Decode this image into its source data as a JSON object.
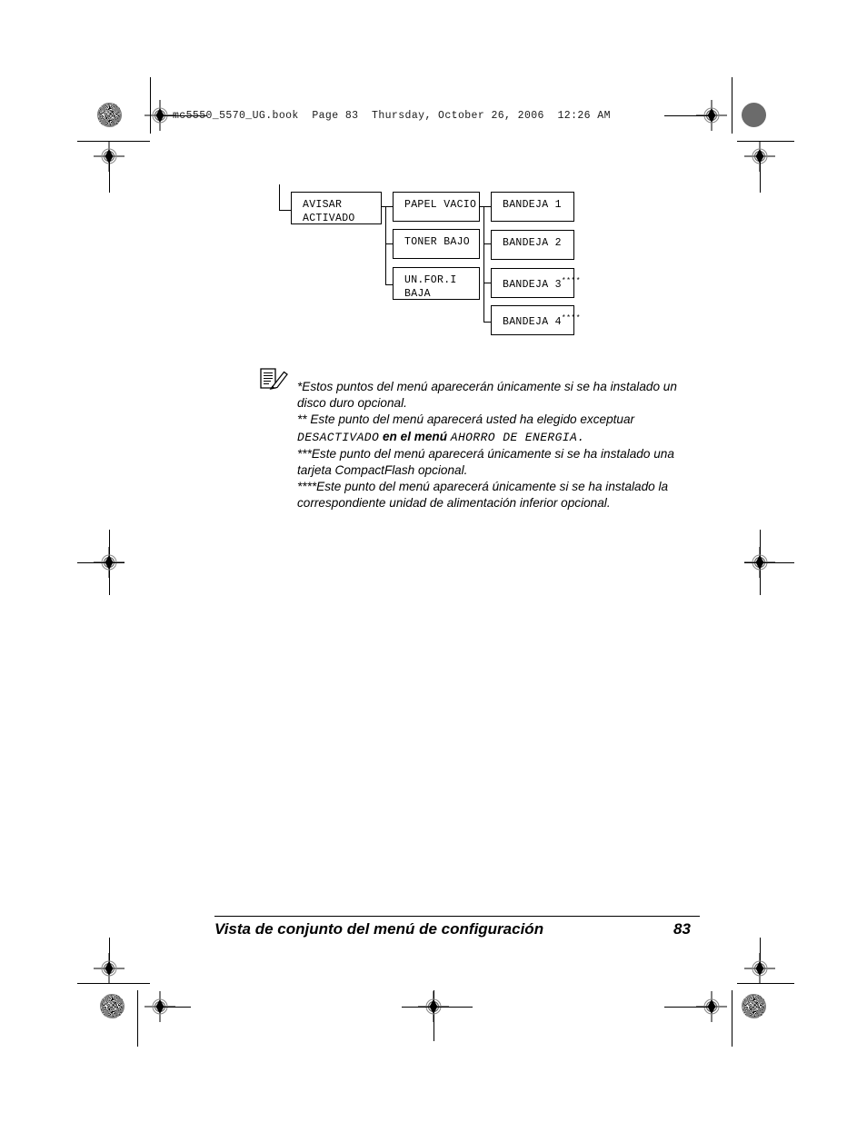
{
  "header": {
    "book_line": "mc5550_5570_UG.book  Page 83  Thursday, October 26, 2006  12:26 AM"
  },
  "diagram": {
    "nodes": [
      {
        "id": "avisar-activado",
        "line1": "AVISAR",
        "line2": "ACTIVADO",
        "sup": ""
      },
      {
        "id": "papel-vacio",
        "line1": "PAPEL VACIO",
        "line2": "",
        "sup": ""
      },
      {
        "id": "toner-bajo",
        "line1": "TONER BAJO",
        "line2": "",
        "sup": ""
      },
      {
        "id": "un-for-i-baja",
        "line1": "UN.FOR.I",
        "line2": "BAJA",
        "sup": ""
      },
      {
        "id": "bandeja-1",
        "line1": "BANDEJA 1",
        "line2": "",
        "sup": ""
      },
      {
        "id": "bandeja-2",
        "line1": "BANDEJA 2",
        "line2": "",
        "sup": ""
      },
      {
        "id": "bandeja-3",
        "line1": "BANDEJA 3",
        "line2": "",
        "sup": "****"
      },
      {
        "id": "bandeja-4",
        "line1": "BANDEJA 4",
        "line2": "",
        "sup": "****"
      }
    ]
  },
  "note": {
    "icon_name": "note-document-pen-icon",
    "line1": "*Estos puntos del menú aparecerán únicamente si se ha instalado un",
    "line2": "disco duro opcional.",
    "line3": "** Este punto del menú aparecerá usted ha elegido exceptuar",
    "line4_mono_a": "DESACTIVADO",
    "line4_sans": " en el menú ",
    "line4_mono_b": "AHORRO DE ENERGIA.",
    "line5": "***Este punto del menú aparecerá únicamente si se ha instalado una",
    "line6": "tarjeta CompactFlash opcional.",
    "line7": "****Este punto del menú aparecerá únicamente si se ha instalado la",
    "line8": "correspondiente unidad de alimentación inferior opcional."
  },
  "footer": {
    "title": "Vista de conjunto del menú de configuración",
    "page_number": "83"
  },
  "colors": {
    "ink": "#000000",
    "paper": "#ffffff",
    "halftone_gray": "#6b6b6b"
  }
}
